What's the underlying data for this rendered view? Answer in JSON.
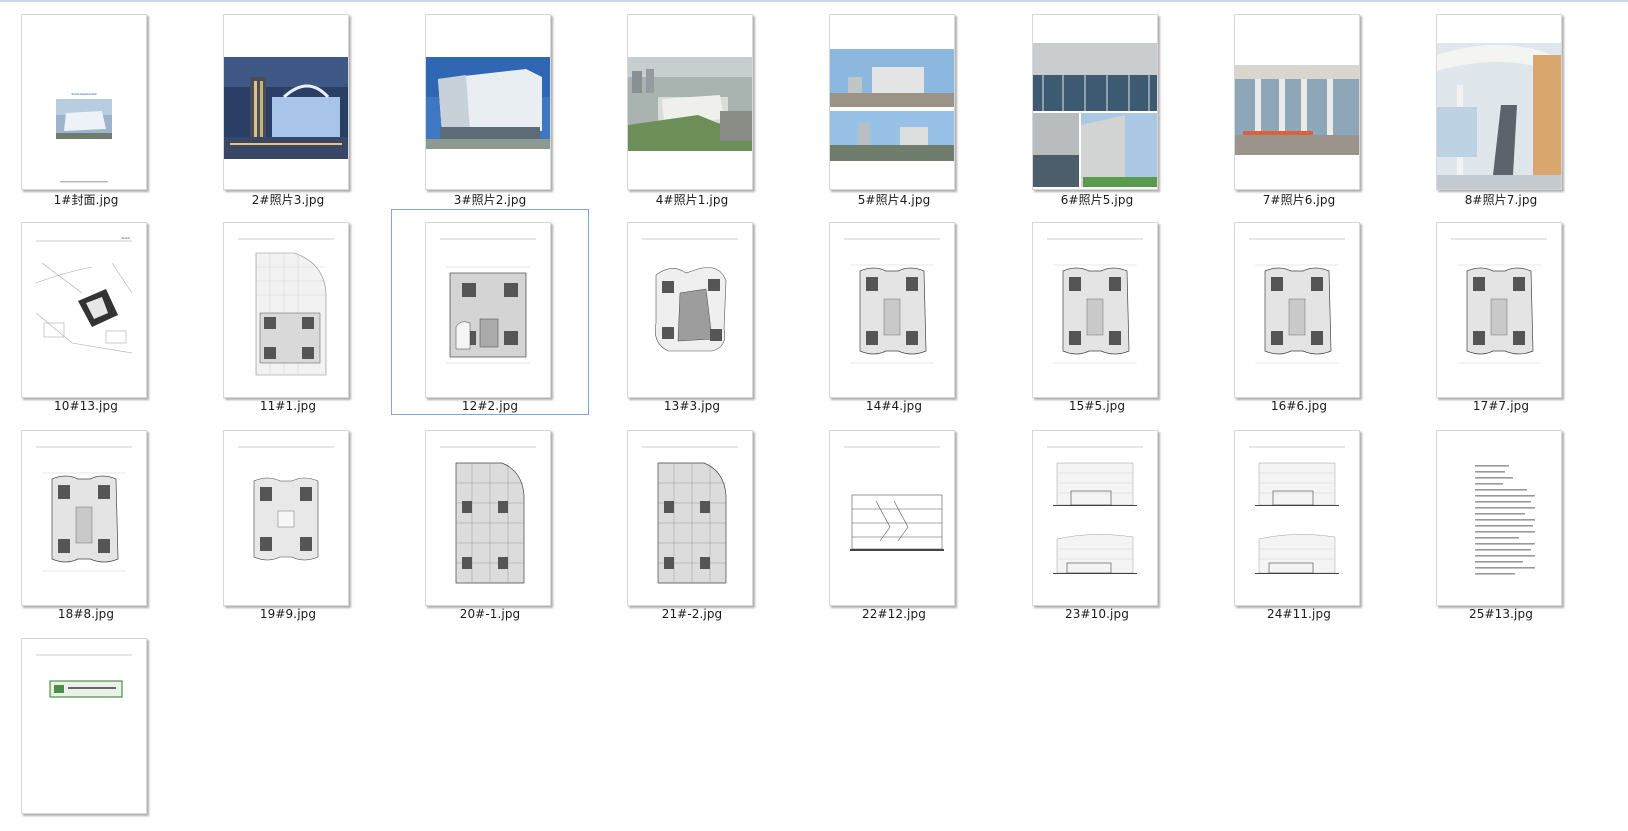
{
  "files": [
    {
      "name": "1#封面.jpg",
      "kind": "cover"
    },
    {
      "name": "2#照片3.jpg",
      "kind": "photo-night"
    },
    {
      "name": "3#照片2.jpg",
      "kind": "photo-white"
    },
    {
      "name": "4#照片1.jpg",
      "kind": "photo-aerial"
    },
    {
      "name": "5#照片4.jpg",
      "kind": "photo-double"
    },
    {
      "name": "6#照片5.jpg",
      "kind": "photo-grid"
    },
    {
      "name": "7#照片6.jpg",
      "kind": "photo-colonnade"
    },
    {
      "name": "8#照片7.jpg",
      "kind": "photo-interior"
    },
    {
      "name": "10#13.jpg",
      "kind": "site-plan"
    },
    {
      "name": "11#1.jpg",
      "kind": "plan-curved"
    },
    {
      "name": "12#2.jpg",
      "kind": "plan-square",
      "selected": true
    },
    {
      "name": "13#3.jpg",
      "kind": "plan-organic"
    },
    {
      "name": "14#4.jpg",
      "kind": "plan-tower"
    },
    {
      "name": "15#5.jpg",
      "kind": "plan-tower"
    },
    {
      "name": "16#6.jpg",
      "kind": "plan-tower"
    },
    {
      "name": "17#7.jpg",
      "kind": "plan-tower"
    },
    {
      "name": "18#8.jpg",
      "kind": "plan-tower"
    },
    {
      "name": "19#9.jpg",
      "kind": "plan-tower-small"
    },
    {
      "name": "20#-1.jpg",
      "kind": "plan-basement"
    },
    {
      "name": "21#-2.jpg",
      "kind": "plan-basement"
    },
    {
      "name": "22#12.jpg",
      "kind": "section"
    },
    {
      "name": "23#10.jpg",
      "kind": "elevation"
    },
    {
      "name": "24#11.jpg",
      "kind": "elevation"
    },
    {
      "name": "25#13.jpg",
      "kind": "text-page"
    },
    {
      "name": "",
      "kind": "certificate"
    }
  ]
}
